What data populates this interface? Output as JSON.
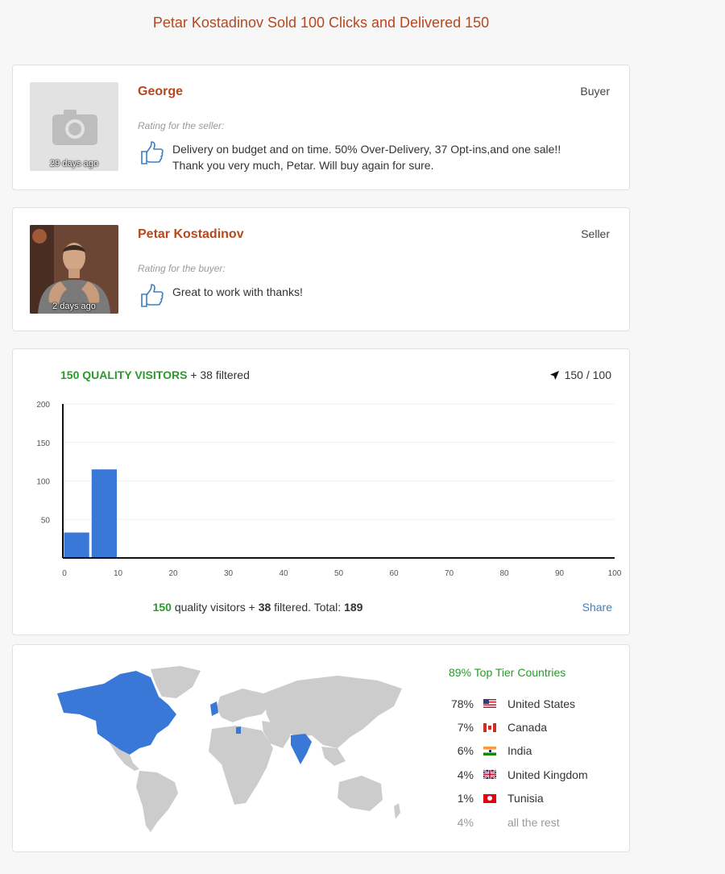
{
  "page": {
    "title": "Petar Kostadinov Sold 100 Clicks and Delivered 150"
  },
  "reviews": [
    {
      "name": "George",
      "role": "Buyer",
      "age": "29 days ago",
      "rating_label": "Rating for the seller:",
      "text_line1": "Delivery on budget and on time. 50% Over-Delivery, 37 Opt-ins,and one sale!!",
      "text_line2": "Thank you very much, Petar. Will buy again for sure.",
      "avatar": "camera-icon"
    },
    {
      "name": "Petar Kostadinov",
      "role": "Seller",
      "age": "2 days ago",
      "rating_label": "Rating for the buyer:",
      "text_line1": "Great to work with thanks!",
      "avatar": "user-photo"
    }
  ],
  "visitors": {
    "quality_label": "150 QUALITY VISITORS",
    "filtered_label": "+ 38 filtered",
    "progress": "150 / 100",
    "footer_quality": "150",
    "footer_mid": "quality visitors +",
    "footer_filtered": "38",
    "footer_total_label": "filtered. Total:",
    "footer_total": "189",
    "share": "Share"
  },
  "chart_data": {
    "type": "bar",
    "x": [
      2.5,
      7.5
    ],
    "values": [
      33,
      115
    ],
    "bar_width": 5,
    "xlim": [
      0,
      100
    ],
    "ylim": [
      0,
      200
    ],
    "x_ticks": [
      0,
      10,
      20,
      30,
      40,
      50,
      60,
      70,
      80,
      90,
      100
    ],
    "y_ticks": [
      50,
      100,
      150,
      200
    ],
    "bar_color": "#3a78d8",
    "grid": true,
    "title": "",
    "xlabel": "",
    "ylabel": ""
  },
  "countries": {
    "top_tier": "89% Top Tier Countries",
    "list": [
      {
        "pct": "78%",
        "name": "United States",
        "flag": "us-flag-icon"
      },
      {
        "pct": "7%",
        "name": "Canada",
        "flag": "ca-flag-icon"
      },
      {
        "pct": "6%",
        "name": "India",
        "flag": "in-flag-icon"
      },
      {
        "pct": "4%",
        "name": "United Kingdom",
        "flag": "gb-flag-icon"
      },
      {
        "pct": "1%",
        "name": "Tunisia",
        "flag": "tn-flag-icon"
      }
    ],
    "rest": {
      "pct": "4%",
      "name": "all the rest"
    },
    "highlight_color": "#3a78d8",
    "land_color": "#cccccc"
  }
}
